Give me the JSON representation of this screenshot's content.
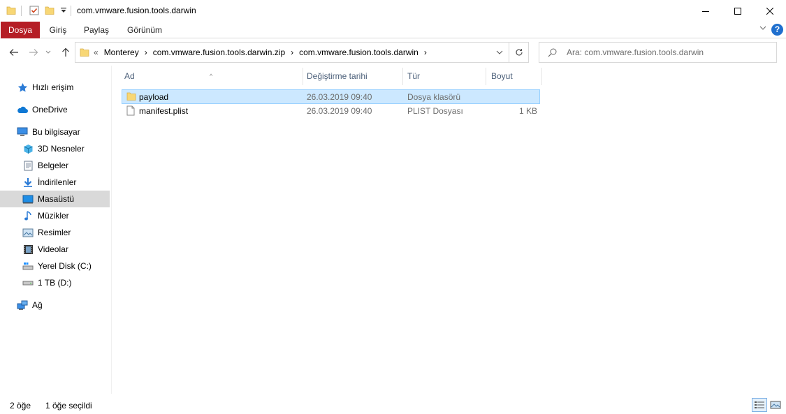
{
  "window": {
    "title": "com.vmware.fusion.tools.darwin",
    "minimize_icon": "minimize-icon",
    "maximize_icon": "maximize-icon",
    "close_icon": "close-icon"
  },
  "ribbon": {
    "tabs": [
      "Dosya",
      "Giriş",
      "Paylaş",
      "Görünüm"
    ],
    "file_tab_color": "#b51d25",
    "help_label": "?"
  },
  "navigation": {
    "breadcrumb_overflow": "«",
    "breadcrumbs": [
      "Monterey",
      "com.vmware.fusion.tools.darwin.zip",
      "com.vmware.fusion.tools.darwin"
    ],
    "search_placeholder": "Ara: com.vmware.fusion.tools.darwin"
  },
  "sidebar": {
    "items": [
      {
        "label": "Hızlı erişim",
        "icon": "star-icon"
      },
      {
        "label": "OneDrive",
        "icon": "cloud-icon"
      },
      {
        "label": "Bu bilgisayar",
        "icon": "computer-icon"
      },
      {
        "label": "3D Nesneler",
        "icon": "cube-icon"
      },
      {
        "label": "Belgeler",
        "icon": "document-icon"
      },
      {
        "label": "İndirilenler",
        "icon": "download-icon"
      },
      {
        "label": "Masaüstü",
        "icon": "desktop-icon",
        "selected": true
      },
      {
        "label": "Müzikler",
        "icon": "music-icon"
      },
      {
        "label": "Resimler",
        "icon": "pictures-icon"
      },
      {
        "label": "Videolar",
        "icon": "video-icon"
      },
      {
        "label": "Yerel Disk (C:)",
        "icon": "drive-icon"
      },
      {
        "label": "1 TB (D:)",
        "icon": "drive-icon"
      },
      {
        "label": "Ağ",
        "icon": "network-icon"
      }
    ]
  },
  "file_list": {
    "columns": [
      "Ad",
      "Değiştirme tarihi",
      "Tür",
      "Boyut"
    ],
    "rows": [
      {
        "name": "payload",
        "date": "26.03.2019 09:40",
        "type": "Dosya klasörü",
        "size": "",
        "icon": "folder-icon",
        "selected": true
      },
      {
        "name": "manifest.plist",
        "date": "26.03.2019 09:40",
        "type": "PLIST Dosyası",
        "size": "1 KB",
        "icon": "file-icon",
        "selected": false
      }
    ]
  },
  "status": {
    "item_count": "2 öğe",
    "selected_count": "1 öğe seçildi"
  }
}
